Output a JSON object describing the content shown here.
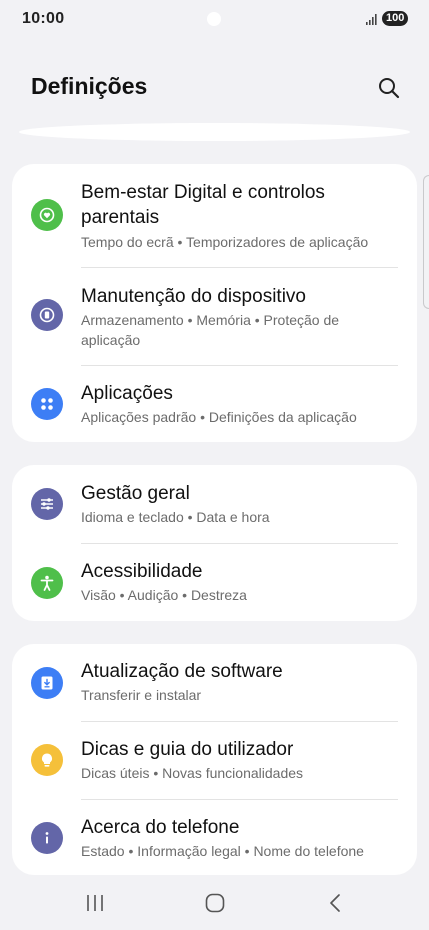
{
  "status_bar": {
    "time": "10:00",
    "battery": "100"
  },
  "header": {
    "title": "Definições"
  },
  "groups": [
    {
      "items": [
        {
          "title": "Bem-estar Digital e controlos",
          "title2": "parentais",
          "subtitle": "Tempo do ecrã • Temporizadores de aplicação",
          "icon": "digital-wellbeing-icon",
          "color": "#4fbf4a"
        },
        {
          "title": "Manutenção do dispositivo",
          "subtitle": "Armazenamento • Memória • Proteção de",
          "subtitle2": "aplicação",
          "icon": "device-care-icon",
          "color": "#6366a8"
        },
        {
          "title": "Aplicações",
          "subtitle": "Aplicações padrão • Definições da aplicação",
          "icon": "apps-icon",
          "color": "#3d7ef5"
        }
      ]
    },
    {
      "items": [
        {
          "title": "Gestão geral",
          "subtitle": "Idioma e teclado • Data e hora",
          "icon": "general-management-icon",
          "color": "#6366a8"
        },
        {
          "title": "Acessibilidade",
          "subtitle": "Visão • Audição • Destreza",
          "icon": "accessibility-icon",
          "color": "#4fbf4a"
        }
      ]
    },
    {
      "items": [
        {
          "title": "Atualização de software",
          "subtitle": "Transferir e instalar",
          "icon": "software-update-icon",
          "color": "#3d7ef5"
        },
        {
          "title": "Dicas e guia do utilizador",
          "subtitle": "Dicas úteis • Novas funcionalidades",
          "icon": "lightbulb-icon",
          "color": "#f5c03a"
        },
        {
          "title": "Acerca do telefone",
          "subtitle": "Estado • Informação legal • Nome do telefone",
          "icon": "info-icon",
          "color": "#6366a8"
        }
      ]
    }
  ],
  "nav_bar": {
    "buttons": [
      "recents-icon",
      "home-icon",
      "back-icon"
    ]
  }
}
